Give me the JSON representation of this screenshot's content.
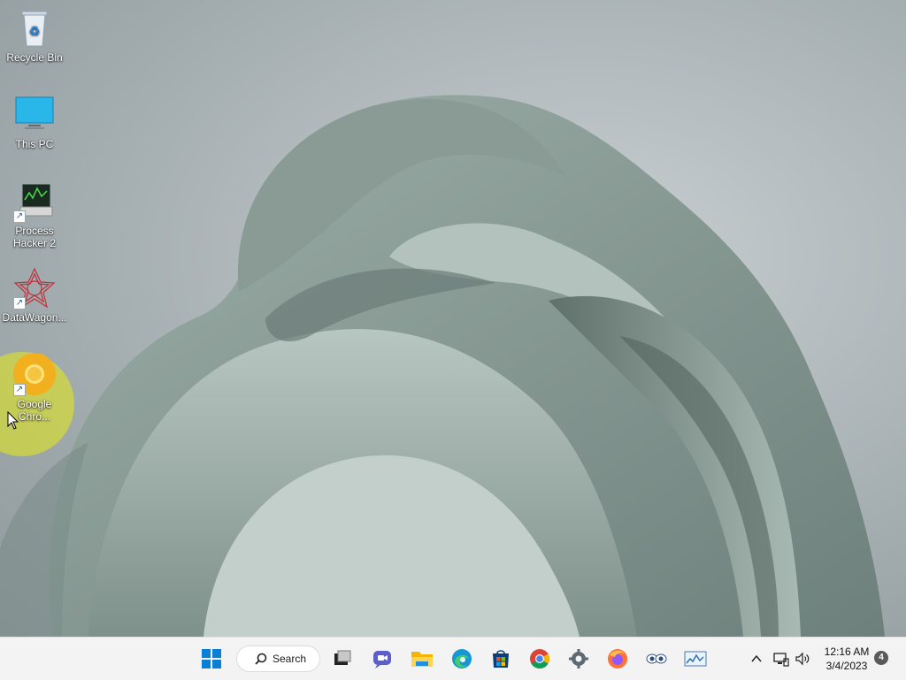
{
  "desktop": {
    "icons": [
      {
        "label": "Recycle Bin"
      },
      {
        "label": "This PC"
      },
      {
        "label": "Process Hacker 2"
      },
      {
        "label": "DataWagon..."
      },
      {
        "label": "Google Chro..."
      }
    ]
  },
  "taskbar": {
    "search_label": "Search",
    "apps": [
      "start-icon",
      "task-view-icon",
      "chat-icon",
      "file-explorer-icon",
      "edge-icon",
      "store-icon",
      "chrome-icon",
      "settings-icon",
      "firefox-icon",
      "eye-app-icon",
      "monitor-app-icon"
    ]
  },
  "tray": {
    "time": "12:16 AM",
    "date": "3/4/2023",
    "notification_count": "4"
  },
  "colors": {
    "taskbar_bg": "#f3f3f3",
    "highlight": "#e6eb14",
    "accent": "#0078d4"
  }
}
